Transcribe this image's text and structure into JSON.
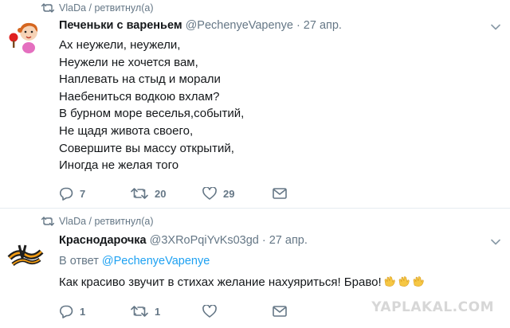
{
  "tweets": [
    {
      "retweet_line": "VlaDa / ретвитнул(а)",
      "name": "Печеньки с вареньем",
      "handle": "@PechenyeVapenye",
      "dot": "·",
      "time": "27 апр.",
      "lines": [
        "Ах неужели, неужели,",
        "Неужели не хочется вам,",
        "Наплевать на стыд и морали",
        "Наебениться водкою вхлам?",
        "В бурном море веселья,событий,",
        "Не щадя живота своего,",
        "Совершите вы массу открытий,",
        "Иногда не желая того"
      ],
      "replies": "7",
      "retweets": "20",
      "likes": "29"
    },
    {
      "retweet_line": "VlaDa / ретвитнул(а)",
      "name": "Краснодарочка",
      "handle": "@3XRoPqiYvKs03gd",
      "dot": "·",
      "time": "27 апр.",
      "reply_prefix": "В ответ",
      "reply_handle": "@PechenyeVapenye",
      "text": "Как красиво звучит в стихах желание нахуяриться! Браво!",
      "replies": "1",
      "retweets": "1",
      "likes": ""
    }
  ],
  "watermark": "YAPLAKAL.COM",
  "icons": [
    "retweet-icon",
    "reply-icon",
    "heart-icon",
    "mail-icon",
    "chevron-down-icon",
    "clapping-hands-icon"
  ],
  "colors": {
    "secondary": "#657786",
    "link": "#1da1f2",
    "text": "#14171a"
  }
}
